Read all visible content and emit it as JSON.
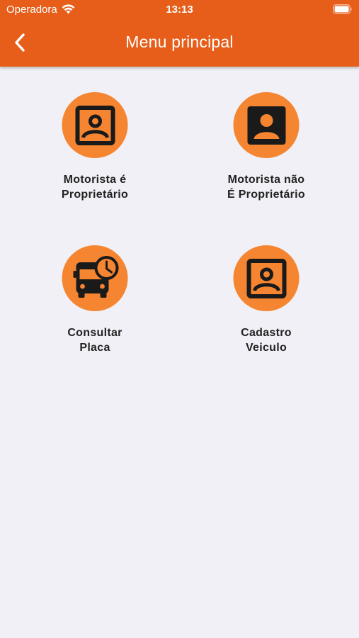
{
  "status_bar": {
    "carrier": "Operadora",
    "time": "13:13",
    "icons": [
      "wifi-icon",
      "battery-icon"
    ]
  },
  "nav": {
    "title": "Menu principal",
    "back_icon": "chevron-left-icon"
  },
  "colors": {
    "header": "#e65e1a",
    "icon_circle": "#f58531",
    "background": "#f1f0f6",
    "label_text": "#222222"
  },
  "menu": {
    "items": [
      {
        "line1": "Motorista é",
        "line2": "Proprietário",
        "icon": "portrait-icon"
      },
      {
        "line1": "Motorista não",
        "line2": "É Proprietário",
        "icon": "account-box-icon"
      },
      {
        "line1": "Consultar",
        "line2": "Placa",
        "icon": "bus-clock-icon"
      },
      {
        "line1": "Cadastro",
        "line2": "Veiculo",
        "icon": "portrait-icon"
      }
    ]
  }
}
